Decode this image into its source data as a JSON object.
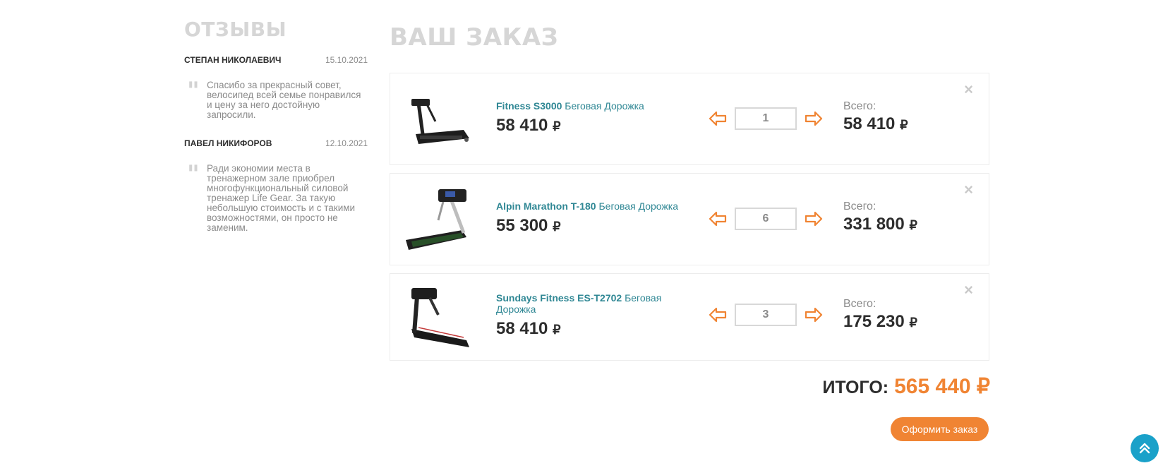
{
  "reviews": {
    "title": "ОТЗЫВЫ",
    "items": [
      {
        "author": "СТЕПАН НИКОЛАЕВИЧ",
        "date": "15.10.2021",
        "text": "Спасибо за прекрасный совет, велосипед всей семье понравился и цену за него достойную запросили."
      },
      {
        "author": "ПАВЕЛ НИКИФОРОВ",
        "date": "12.10.2021",
        "text": "Ради экономии места в тренажерном зале приобрел многофункциональный силовой тренажер Life Gear. За такую небольшую стоимость и с такими возможностями, он просто не заменим."
      }
    ]
  },
  "order": {
    "title": "ВАШ ЗАКАЗ",
    "total_label": "Всего:",
    "currency": "₽",
    "items": [
      {
        "model": "Fitness S3000",
        "type": "Беговая Дорожка",
        "price": "58 410",
        "quantity": "1",
        "total": "58 410"
      },
      {
        "model": "Alpin Marathon T-180",
        "type": "Беговая Дорожка",
        "price": "55 300",
        "quantity": "6",
        "total": "331 800"
      },
      {
        "model": "Sundays Fitness ES-T2702",
        "type": "Беговая Дорожка",
        "price": "58 410",
        "quantity": "3",
        "total": "175 230"
      }
    ],
    "grand_total_label": "ИТОГО:",
    "grand_total": "565 440 ₽",
    "checkout_label": "Оформить заказ",
    "remove_symbol": "×"
  },
  "icons": {
    "decrease": "arrow-left-icon",
    "increase": "arrow-right-icon",
    "scroll_top": "double-chevron-up-icon"
  },
  "colors": {
    "accent": "#f08433",
    "link": "#2f8794",
    "scroll_button": "#1aa1c9"
  }
}
